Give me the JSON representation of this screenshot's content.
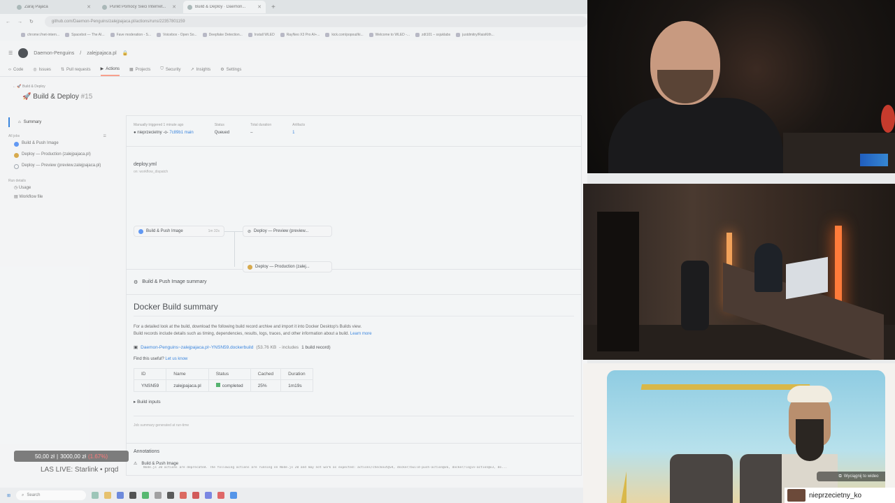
{
  "browser": {
    "tabs": [
      {
        "label": "Zaraj Pajaca"
      },
      {
        "label": "Punkt Pomocy Sieci Internet..."
      },
      {
        "label": "Build & Deploy · Daemon..."
      }
    ],
    "url": "github.com/Daemon-Penguins/zalejpajaca.pl/actions/runs/22357801159",
    "bookmarks": [
      "chrome://net-intern...",
      "Spacebot — The AI...",
      "Fave moderation - S...",
      "Voicebox - Open So...",
      "Deepfake Detection...",
      "Install WLED",
      "RayNeo X3 Pro AI+...",
      "kick.com/popout/ki...",
      "Welcome to WLED -...",
      "zdt101 – ssjuklabs",
      "justdmitry/RaisKith..."
    ]
  },
  "github": {
    "org": "Daemon-Penguins",
    "repo": "zalejpajaca.pl",
    "nav": [
      "Code",
      "Issues",
      "Pull requests",
      "Actions",
      "Projects",
      "Security",
      "Insights",
      "Settings"
    ],
    "breadcrumb": "Build & Deploy",
    "run_title": "Build & Deploy",
    "run_number": "#15"
  },
  "sidebar": {
    "summary": "Summary",
    "all_jobs": "All jobs",
    "jobs": [
      {
        "label": "Build & Push Image"
      },
      {
        "label": "Deploy — Production (zalejpajaca.pl)"
      },
      {
        "label": "Deploy — Preview (preview.zalejpajaca.pl)"
      }
    ],
    "run_details": "Run details",
    "usage": "Usage",
    "workflow_file": "Workflow file"
  },
  "meta": {
    "trigger_label": "Manually triggered 1 minute ago",
    "user": "nieprzecietny",
    "commit": "7c89b1",
    "branch": "main",
    "status_label": "Status",
    "status": "Queued",
    "duration_label": "Total duration",
    "duration": "–",
    "artifacts_label": "Artifacts",
    "artifacts": "1"
  },
  "graph": {
    "workflow_file": "deploy.yml",
    "trigger": "on: workflow_dispatch",
    "build_job": "Build & Push Image",
    "build_time": "1m 32s",
    "preview_job": "Deploy — Preview (preview...",
    "prod_job": "Deploy — Production (zalej..."
  },
  "summary": {
    "head": "Build & Push Image summary",
    "title": "Docker Build summary",
    "para1": "For a detailed look at the build, download the following build record archive and import it into Docker Desktop's Builds view.",
    "para2": "Build records include details such as timing, dependencies, results, logs, traces, and other information about a build.",
    "learn_more": "Learn more",
    "file_link": "Daemon-Penguins~zalejpajaca.pl~YNSN59.dockerbuild",
    "file_size": "(53.76 KB",
    "file_includes": "- includes",
    "file_records": "1 build record)",
    "useful": "Find this useful?",
    "let_us_know": "Let us know",
    "table_headers": [
      "ID",
      "Name",
      "Status",
      "Cached",
      "Duration"
    ],
    "table_rows": [
      {
        "id": "YNSN59",
        "name": "zalejpajaca.pl",
        "status": "completed",
        "cached": "25%",
        "duration": "1m19s"
      }
    ],
    "build_inputs": "Build inputs",
    "generated": "Job summary generated at run-time"
  },
  "annotations": {
    "title": "Annotations",
    "item": "Build & Push Image",
    "message": "Node.js 20 actions are deprecated. The following actions are running on Node.js 20 and may not work as expected: actions/checkout@v4, docker/build-push-action@v6, docker/login-action@v3, do..."
  },
  "overlay": {
    "amount": "50,00 zł",
    "goal": "3000,00 zł",
    "percent": "(1.67%)",
    "stream_title": "LAS LIVE: Starlink • prqd"
  },
  "taskbar": {
    "search": "Search"
  },
  "video": {
    "unmute_label": "Wyciągnij to wideo"
  },
  "chat": {
    "username": "nieprzecietny_ko"
  }
}
